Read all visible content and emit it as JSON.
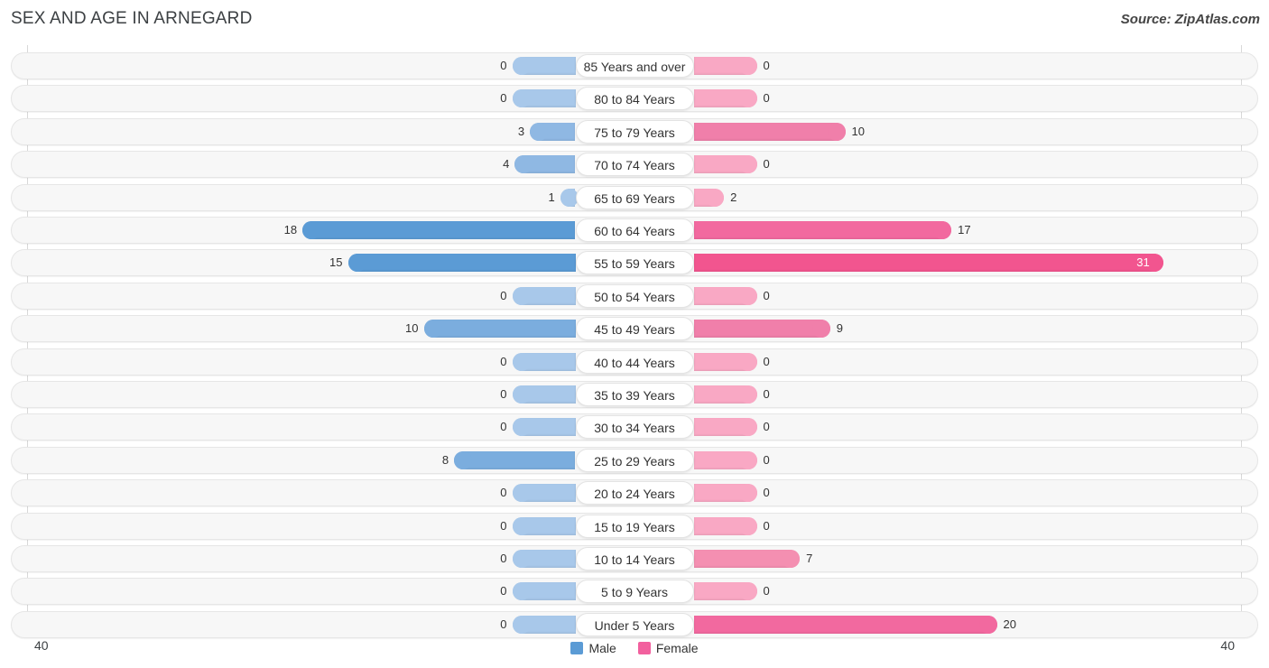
{
  "title": "SEX AND AGE IN ARNEGARD",
  "source": "Source: ZipAtlas.com",
  "axis": {
    "left_tick": "40",
    "right_tick": "40"
  },
  "legend": [
    {
      "label": "Male",
      "color": "#5B9BD5"
    },
    {
      "label": "Female",
      "color": "#F2609E"
    }
  ],
  "chart_data": {
    "type": "bar",
    "subtype": "population-pyramid",
    "title": "SEX AND AGE IN ARNEGARD",
    "xlabel": "",
    "ylabel": "",
    "xlim": [
      -40,
      40
    ],
    "axis_max": 40,
    "grid": false,
    "legend_position": "bottom-center",
    "categories": [
      "85 Years and over",
      "80 to 84 Years",
      "75 to 79 Years",
      "70 to 74 Years",
      "65 to 69 Years",
      "60 to 64 Years",
      "55 to 59 Years",
      "50 to 54 Years",
      "45 to 49 Years",
      "40 to 44 Years",
      "35 to 39 Years",
      "30 to 34 Years",
      "25 to 29 Years",
      "20 to 24 Years",
      "15 to 19 Years",
      "10 to 14 Years",
      "5 to 9 Years",
      "Under 5 Years"
    ],
    "series": [
      {
        "name": "Male",
        "color": "#5B9BD5",
        "direction": "left",
        "values": [
          0,
          0,
          3,
          4,
          1,
          18,
          15,
          0,
          10,
          0,
          0,
          0,
          8,
          0,
          0,
          0,
          0,
          0
        ]
      },
      {
        "name": "Female",
        "color": "#F2609E",
        "direction": "right",
        "values": [
          0,
          0,
          10,
          0,
          2,
          17,
          31,
          0,
          9,
          0,
          0,
          0,
          0,
          0,
          0,
          7,
          0,
          20
        ]
      }
    ]
  },
  "rows": [
    {
      "label": "85 Years and over",
      "male": 0,
      "female": 0,
      "male_text": "0",
      "female_text": "0"
    },
    {
      "label": "80 to 84 Years",
      "male": 0,
      "female": 0,
      "male_text": "0",
      "female_text": "0"
    },
    {
      "label": "75 to 79 Years",
      "male": 3,
      "female": 10,
      "male_text": "3",
      "female_text": "10"
    },
    {
      "label": "70 to 74 Years",
      "male": 4,
      "female": 0,
      "male_text": "4",
      "female_text": "0"
    },
    {
      "label": "65 to 69 Years",
      "male": 1,
      "female": 2,
      "male_text": "1",
      "female_text": "2"
    },
    {
      "label": "60 to 64 Years",
      "male": 18,
      "female": 17,
      "male_text": "18",
      "female_text": "17"
    },
    {
      "label": "55 to 59 Years",
      "male": 15,
      "female": 31,
      "male_text": "15",
      "female_text": "31"
    },
    {
      "label": "50 to 54 Years",
      "male": 0,
      "female": 0,
      "male_text": "0",
      "female_text": "0"
    },
    {
      "label": "45 to 49 Years",
      "male": 10,
      "female": 9,
      "male_text": "10",
      "female_text": "9"
    },
    {
      "label": "40 to 44 Years",
      "male": 0,
      "female": 0,
      "male_text": "0",
      "female_text": "0"
    },
    {
      "label": "35 to 39 Years",
      "male": 0,
      "female": 0,
      "male_text": "0",
      "female_text": "0"
    },
    {
      "label": "30 to 34 Years",
      "male": 0,
      "female": 0,
      "male_text": "0",
      "female_text": "0"
    },
    {
      "label": "25 to 29 Years",
      "male": 8,
      "female": 0,
      "male_text": "8",
      "female_text": "0"
    },
    {
      "label": "20 to 24 Years",
      "male": 0,
      "female": 0,
      "male_text": "0",
      "female_text": "0"
    },
    {
      "label": "15 to 19 Years",
      "male": 0,
      "female": 0,
      "male_text": "0",
      "female_text": "0"
    },
    {
      "label": "10 to 14 Years",
      "male": 0,
      "female": 7,
      "male_text": "0",
      "female_text": "7"
    },
    {
      "label": "5 to 9 Years",
      "male": 0,
      "female": 0,
      "male_text": "0",
      "female_text": "0"
    },
    {
      "label": "Under 5 Years",
      "male": 0,
      "female": 20,
      "male_text": "0",
      "female_text": "20"
    }
  ]
}
